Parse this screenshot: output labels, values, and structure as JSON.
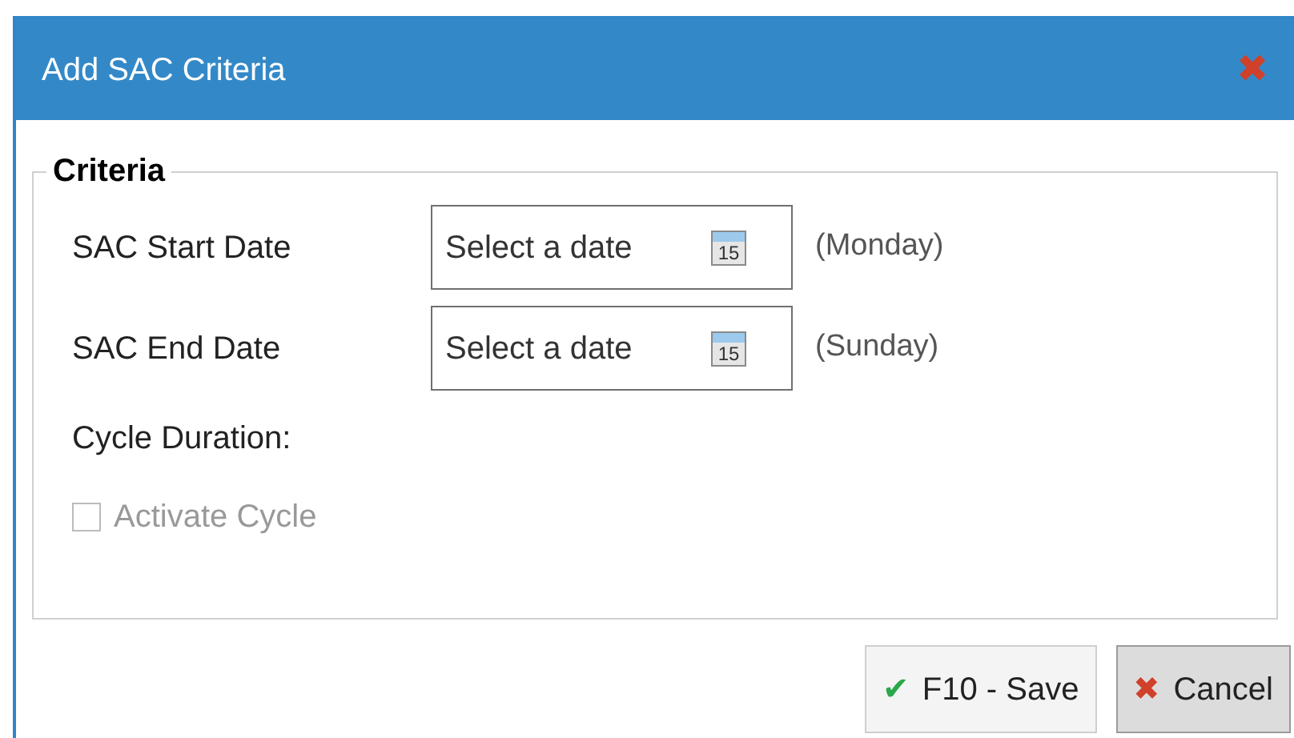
{
  "window": {
    "title": "Add SAC Criteria",
    "close": "✖"
  },
  "group": {
    "title": "Criteria"
  },
  "date_fields": [
    {
      "label": "SAC Start Date",
      "placeholder": "Select a date",
      "calendar_day": "15",
      "hint": "(Monday)"
    },
    {
      "label": "SAC End Date",
      "placeholder": "Select a date",
      "calendar_day": "15",
      "hint": "(Sunday)"
    }
  ],
  "cycle_duration": {
    "label": "Cycle Duration:"
  },
  "activate_cycle": {
    "label": "Activate Cycle",
    "checked": false,
    "disabled": true
  },
  "buttons": [
    {
      "kind": "save",
      "label": "F10 - Save",
      "icon": "✔"
    },
    {
      "kind": "cancel",
      "label": "Cancel",
      "icon": "✖"
    }
  ]
}
